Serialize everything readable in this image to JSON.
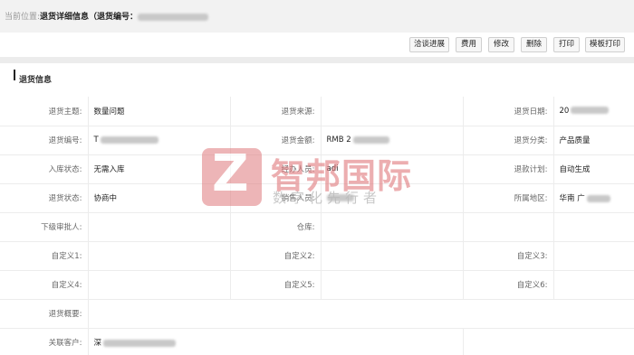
{
  "breadcrumb": {
    "lead": "当前位置:",
    "title": "退货详细信息（退货编号："
  },
  "toolbar": {
    "buttons": [
      "洽谈进展",
      "费用",
      "修改",
      "删除",
      "打印",
      "模板打印"
    ]
  },
  "section": {
    "title": "退货信息"
  },
  "form": {
    "rows": [
      [
        {
          "label": "退货主题:",
          "value": "数量问题"
        },
        {
          "label": "退货来源:",
          "value": ""
        },
        {
          "label": "退货日期:",
          "value": "20"
        }
      ],
      [
        {
          "label": "退货编号:",
          "value": "T"
        },
        {
          "label": "退货金额:",
          "value": "RMB 2"
        },
        {
          "label": "退货分类:",
          "value": "产品质量"
        }
      ],
      [
        {
          "label": "入库状态:",
          "value": "无需入库"
        },
        {
          "label": "经办人员:",
          "value": "adi"
        },
        {
          "label": "退款计划:",
          "value": "自动生成"
        }
      ],
      [
        {
          "label": "退货状态:",
          "value": "协商中"
        },
        {
          "label": "销售人员:",
          "value": ""
        },
        {
          "label": "所属地区:",
          "value": "华南 广"
        }
      ],
      [
        {
          "label": "下级审批人:",
          "value": ""
        },
        {
          "label": "仓库:",
          "value": ""
        },
        {
          "label": "",
          "value": ""
        }
      ],
      [
        {
          "label": "自定义1:",
          "value": ""
        },
        {
          "label": "自定义2:",
          "value": ""
        },
        {
          "label": "自定义3:",
          "value": ""
        }
      ],
      [
        {
          "label": "自定义4:",
          "value": ""
        },
        {
          "label": "自定义5:",
          "value": ""
        },
        {
          "label": "自定义6:",
          "value": ""
        }
      ],
      [
        {
          "label": "退货概要:",
          "value": ""
        }
      ],
      [
        {
          "label": "关联客户:",
          "value": "深"
        }
      ]
    ]
  },
  "watermark": {
    "logo_letter": "Z",
    "name": "智邦国际",
    "slogan": "数字化先行者",
    "color": "#e07a7d"
  },
  "icons": {
    "section_marker": "vertical-bar-icon"
  }
}
